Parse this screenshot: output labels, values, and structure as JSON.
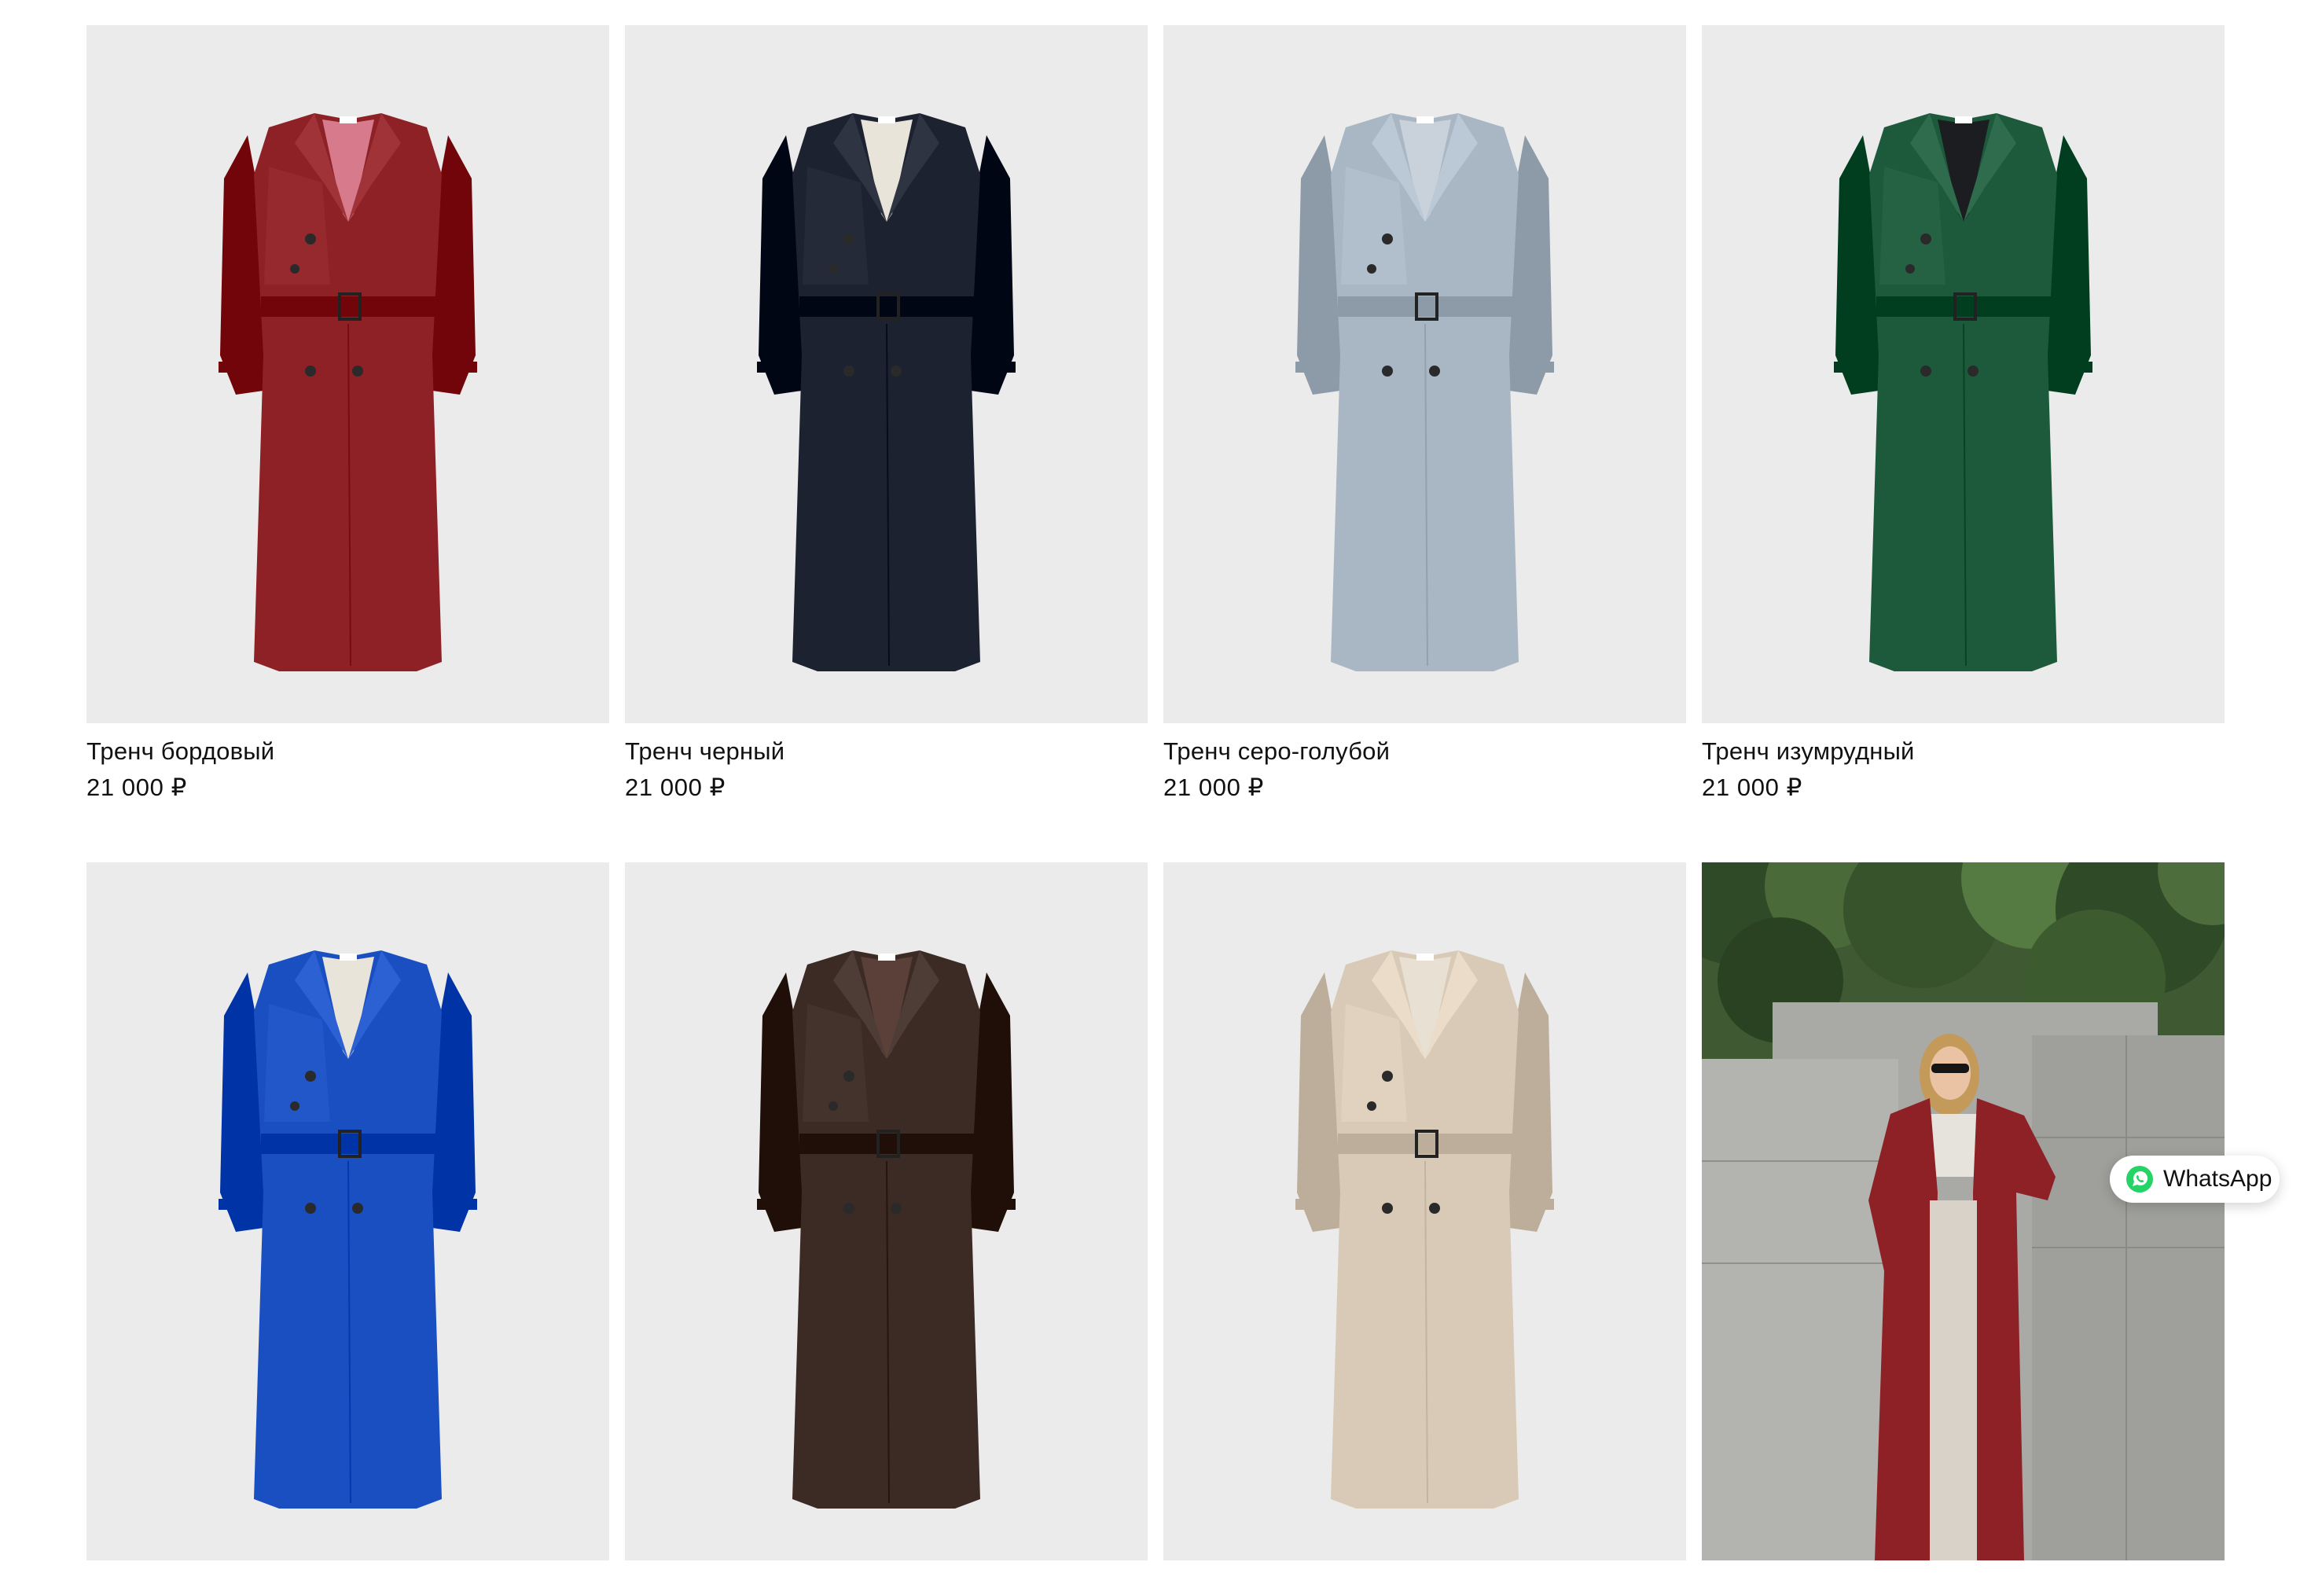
{
  "products": [
    {
      "title": "Тренч бордовый",
      "price": "21 000 ₽",
      "color": "#8e2126",
      "lining": "#d77a8c",
      "image": "coat-packshot"
    },
    {
      "title": "Тренч черный",
      "price": "21 000 ₽",
      "color": "#1d2230",
      "lining": "#e8e4da",
      "image": "coat-packshot"
    },
    {
      "title": "Тренч серо-голубой",
      "price": "21 000 ₽",
      "color": "#a9b6c4",
      "lining": "#c9d1da",
      "image": "coat-packshot"
    },
    {
      "title": "Тренч изумрудный",
      "price": "21 000 ₽",
      "color": "#1d5a3c",
      "lining": "#1b1d20",
      "image": "coat-packshot"
    },
    {
      "title": "",
      "price": "",
      "color": "#1a4fc2",
      "lining": "#e8e4da",
      "image": "coat-packshot"
    },
    {
      "title": "",
      "price": "",
      "color": "#3c2a24",
      "lining": "#5a4038",
      "image": "coat-packshot"
    },
    {
      "title": "",
      "price": "",
      "color": "#d8cab7",
      "lining": "#e8e0d2",
      "image": "coat-packshot"
    },
    {
      "title": "",
      "price": "",
      "color": "#8e2126",
      "lining": "#d8d2c8",
      "image": "model-photo"
    }
  ],
  "whatsapp": {
    "label": "WhatsApp",
    "icon": "whatsapp-icon",
    "color": "#25d366"
  }
}
